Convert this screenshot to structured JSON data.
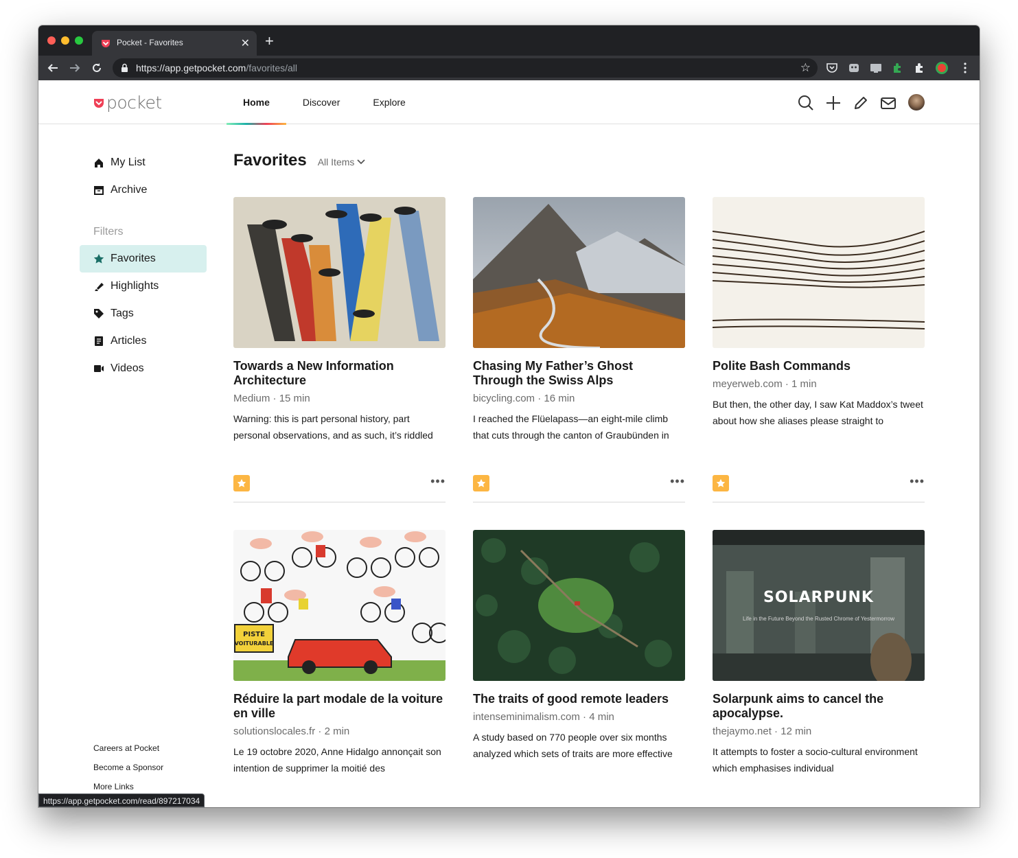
{
  "browser": {
    "tab_title": "Pocket - Favorites",
    "url_host": "https://app.getpocket.com",
    "url_path": "/favorites/all",
    "status_url": "https://app.getpocket.com/read/897217034"
  },
  "header": {
    "logo_text": "pocket",
    "nav": [
      {
        "label": "Home",
        "active": true
      },
      {
        "label": "Discover",
        "active": false
      },
      {
        "label": "Explore",
        "active": false
      }
    ]
  },
  "sidebar": {
    "items": [
      {
        "label": "My List",
        "icon": "home-icon"
      },
      {
        "label": "Archive",
        "icon": "archive-icon"
      }
    ],
    "filters_label": "Filters",
    "filters": [
      {
        "label": "Favorites",
        "icon": "star-icon",
        "active": true
      },
      {
        "label": "Highlights",
        "icon": "highlighter-icon"
      },
      {
        "label": "Tags",
        "icon": "tag-icon"
      },
      {
        "label": "Articles",
        "icon": "article-icon"
      },
      {
        "label": "Videos",
        "icon": "video-icon"
      }
    ],
    "footer_links": [
      "Careers at Pocket",
      "Become a Sponsor",
      "More Links"
    ]
  },
  "main": {
    "title": "Favorites",
    "filter_label": "All Items",
    "cards": [
      {
        "title": "Towards a New Information Architecture",
        "source": "Medium",
        "time": "15 min",
        "excerpt": "Warning: this is part personal history, part personal observations, and as such, it’s riddled",
        "favorited": true
      },
      {
        "title": "Chasing My Father’s Ghost Through the Swiss Alps",
        "source": "bicycling.com",
        "time": "16 min",
        "excerpt": "I reached the Flüelapass—an eight-mile climb that cuts through the canton of Graubünden in",
        "favorited": true
      },
      {
        "title": "Polite Bash Commands",
        "source": "meyerweb.com",
        "time": "1 min",
        "excerpt": "But then, the other day, I saw Kat Maddox’s tweet about how she aliases please straight to",
        "favorited": true
      },
      {
        "title": "Réduire la part modale de la voiture en ville",
        "source": "solutionslocales.fr",
        "time": "2 min",
        "excerpt": "Le 19 octobre 2020, Anne Hidalgo annonçait son intention de supprimer la moitié des",
        "thumb_text": "PISTE VOITURABLE"
      },
      {
        "title": "The traits of good remote leaders",
        "source": "intenseminimalism.com",
        "time": "4 min",
        "excerpt": "A study based on 770 people over six months analyzed which sets of traits are more effective"
      },
      {
        "title": "Solarpunk aims to cancel the apocalypse.",
        "source": "thejaymo.net",
        "time": "12 min",
        "excerpt": "It attempts to foster a socio-cultural environment which emphasises individual",
        "thumb_text": "SOLARPUNK",
        "thumb_subtext": "Life in the Future Beyond the Rusted Chrome of Yestermorrow"
      }
    ]
  },
  "colors": {
    "accent": "#ef4056",
    "active_filter_bg": "#d7f0ee",
    "favorite": "#fcb643"
  }
}
